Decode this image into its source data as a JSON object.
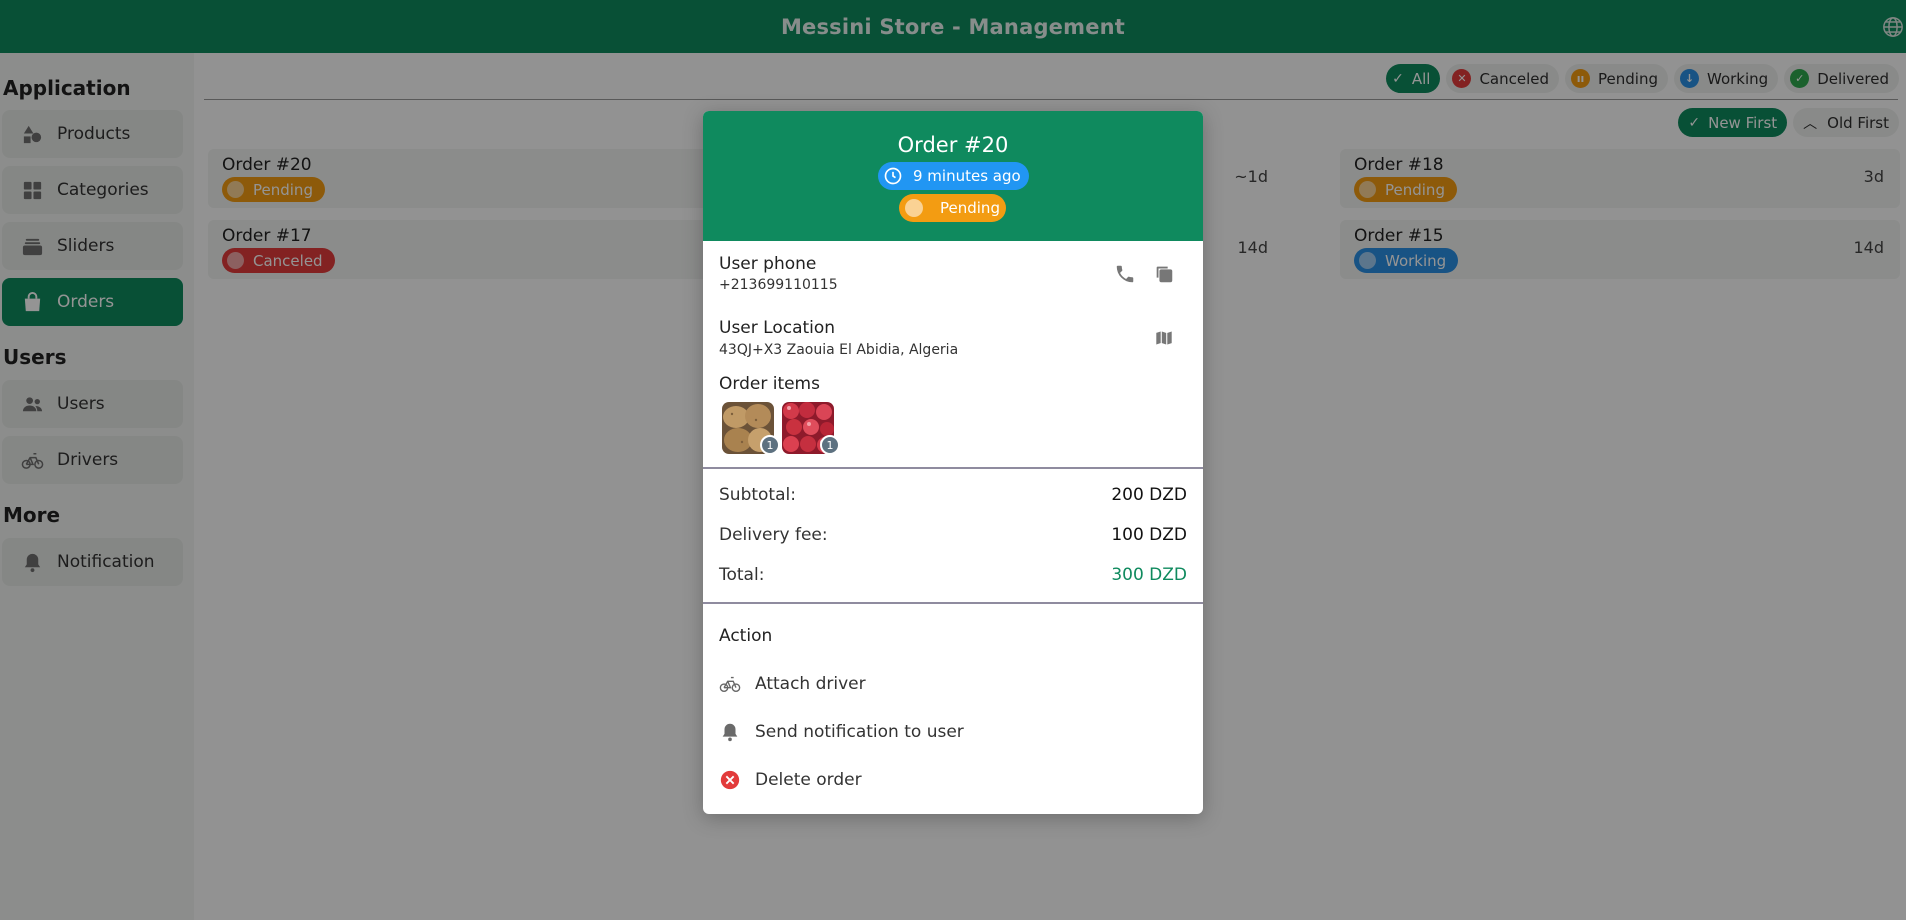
{
  "app": {
    "title": "Messini Store - Management"
  },
  "colors": {
    "brand": "#0f8a5e",
    "pending": "#f39c12",
    "canceled": "#e23b3b",
    "working": "#2a8fe3",
    "time": "#2196f3"
  },
  "sidebar": {
    "sections": {
      "application": "Application",
      "users": "Users",
      "more": "More"
    },
    "items": [
      {
        "label": "Products",
        "icon": "shapes-icon"
      },
      {
        "label": "Categories",
        "icon": "grid-icon"
      },
      {
        "label": "Sliders",
        "icon": "layers-icon"
      },
      {
        "label": "Orders",
        "icon": "bag-icon",
        "active": true
      },
      {
        "label": "Users",
        "icon": "people-icon"
      },
      {
        "label": "Drivers",
        "icon": "bicycle-icon"
      },
      {
        "label": "Notification",
        "icon": "bell-icon"
      }
    ]
  },
  "filters": {
    "chips": [
      {
        "label": "All",
        "active": true
      },
      {
        "label": "Canceled"
      },
      {
        "label": "Pending"
      },
      {
        "label": "Working"
      },
      {
        "label": "Delivered"
      }
    ]
  },
  "sort": {
    "new_first": "New First",
    "old_first": "Old First"
  },
  "orders": [
    {
      "name": "Order #20",
      "status": "Pending",
      "age": "~1d"
    },
    {
      "name": "Order #18",
      "status": "Pending",
      "age": "3d"
    },
    {
      "name": "Order #17",
      "status": "Canceled",
      "age": "14d"
    },
    {
      "name": "Order #15",
      "status": "Working",
      "age": "14d"
    }
  ],
  "modal": {
    "title": "Order #20",
    "time_ago": "9 minutes ago",
    "status": "Pending",
    "phone_label": "User phone",
    "phone_value": "+213699110115",
    "location_label": "User Location",
    "location_value": "43QJ+X3 Zaouia El Abidia, Algeria",
    "items_label": "Order items",
    "items": [
      {
        "name": "potatoes",
        "qty": "1"
      },
      {
        "name": "cranberries",
        "qty": "1"
      }
    ],
    "subtotal_label": "Subtotal:",
    "subtotal_value": "200 DZD",
    "delivery_label": "Delivery fee:",
    "delivery_value": "100 DZD",
    "total_label": "Total:",
    "total_value": "300 DZD",
    "action_title": "Action",
    "actions": [
      {
        "label": "Attach driver",
        "icon": "bicycle-icon"
      },
      {
        "label": "Send notification to user",
        "icon": "bell-icon"
      },
      {
        "label": "Delete order",
        "icon": "delete-icon"
      }
    ]
  }
}
